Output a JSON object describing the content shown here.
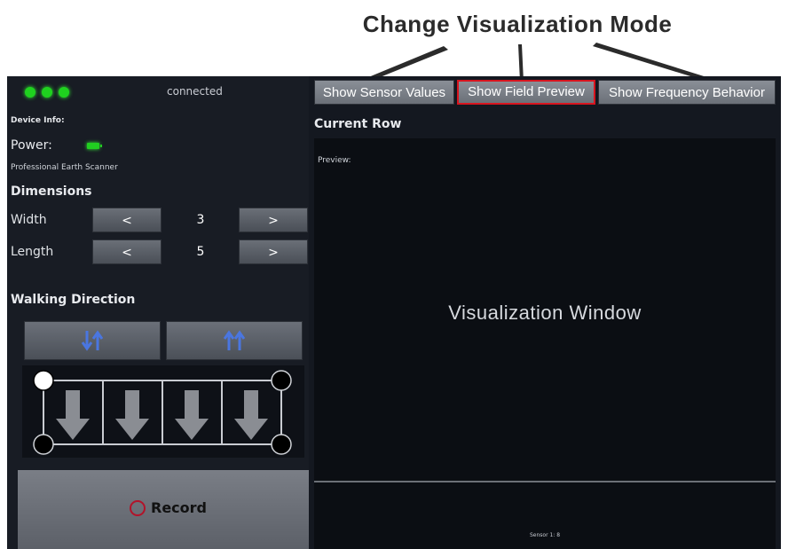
{
  "annotation": {
    "title": "Change Visualization Mode"
  },
  "status": {
    "connection": "connected",
    "dot_color": "#1fd21f"
  },
  "device": {
    "info_label": "Device Info:",
    "power_label": "Power:",
    "model": "Professional Earth Scanner"
  },
  "dimensions": {
    "title": "Dimensions",
    "width_label": "Width",
    "length_label": "Length",
    "decrement": "<",
    "increment": ">",
    "width_value": "3",
    "length_value": "5"
  },
  "walking": {
    "title": "Walking Direction",
    "options": [
      "alternating-arrows-icon",
      "same-direction-arrows-icon"
    ]
  },
  "record": {
    "label": "Record",
    "accent": "#b2132a"
  },
  "tabs": [
    {
      "label": "Show Sensor Values",
      "active": false
    },
    {
      "label": "Show Field Preview",
      "active": true
    },
    {
      "label": "Show Frequency Behavior",
      "active": false
    }
  ],
  "main": {
    "current_row": "Current Row",
    "preview_label": "Preview:",
    "visualization_label": "Visualization Window",
    "sensor_label": "Sensor 1: 8"
  },
  "colors": {
    "active_border": "#d8141e",
    "arrow_blue": "#4a76e0"
  }
}
